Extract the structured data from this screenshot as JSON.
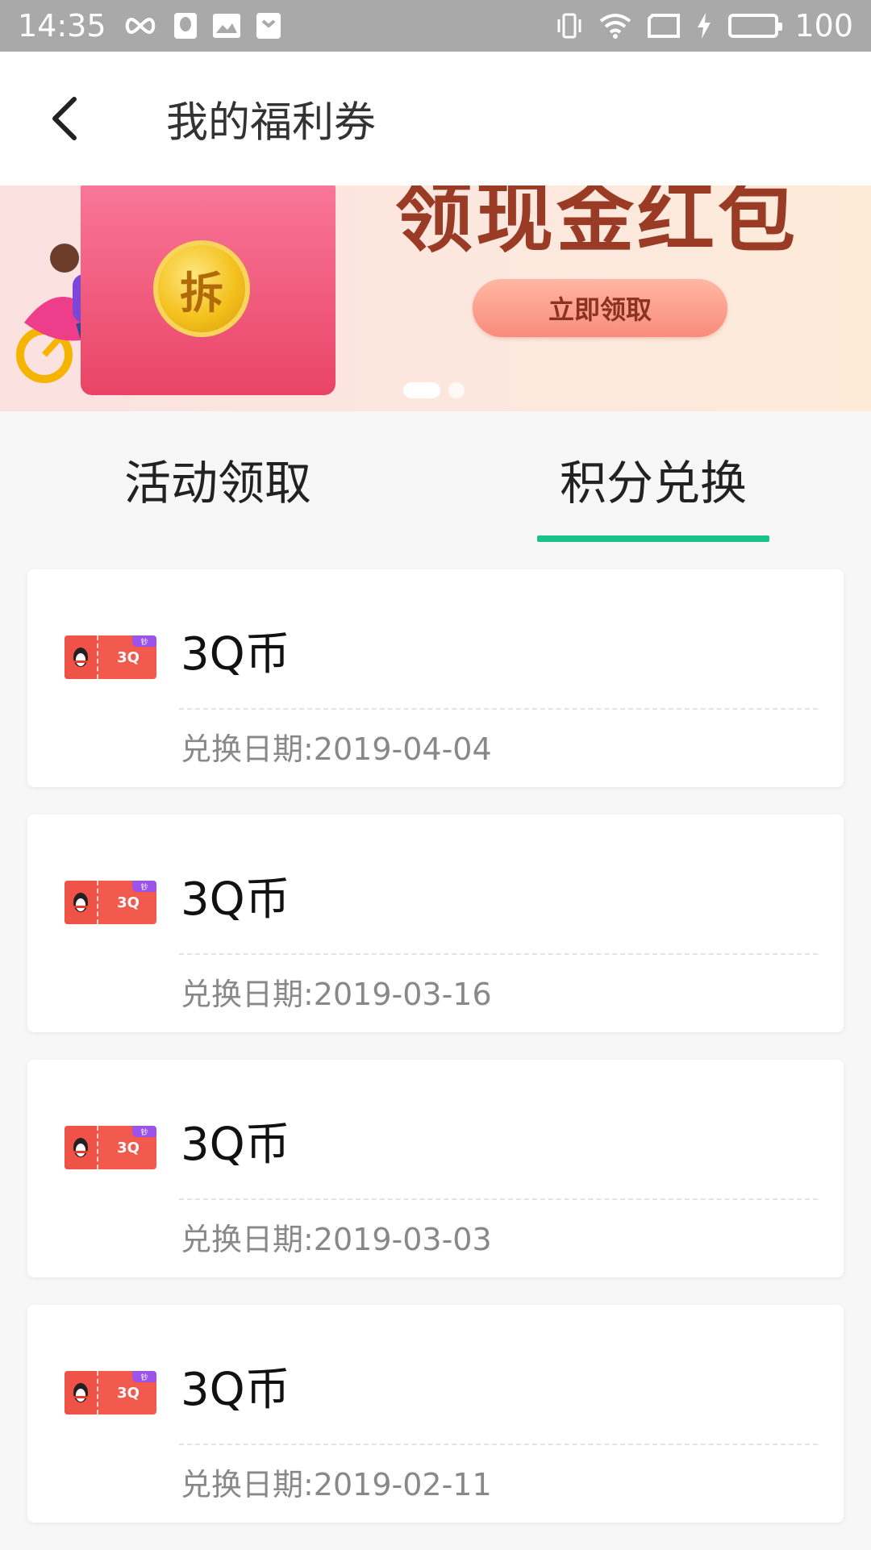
{
  "status_bar": {
    "time": "14:35",
    "battery": "100",
    "icons": [
      "infinity-icon",
      "qq-icon",
      "image-icon",
      "shield-icon",
      "vibrate-icon",
      "wifi-icon",
      "tablet-icon",
      "charging-icon",
      "battery-icon"
    ]
  },
  "header": {
    "title": "我的福利券",
    "back_icon": "back-arrow-icon"
  },
  "banner": {
    "title": "领现金红包",
    "button_label": "立即领取",
    "coin_text": "拆",
    "slide_index": 1,
    "slide_count": 2
  },
  "tabs": [
    {
      "label": "活动领取",
      "active": false
    },
    {
      "label": "积分兑换",
      "active": true
    }
  ],
  "accent_color": "#19c28a",
  "coupons": [
    {
      "title": "3Q币",
      "icon_value": "3Q",
      "badge": "钞",
      "date": "兑换日期:2019-04-04"
    },
    {
      "title": "3Q币",
      "icon_value": "3Q",
      "badge": "钞",
      "date": "兑换日期:2019-03-16"
    },
    {
      "title": "3Q币",
      "icon_value": "3Q",
      "badge": "钞",
      "date": "兑换日期:2019-03-03"
    },
    {
      "title": "3Q币",
      "icon_value": "3Q",
      "badge": "钞",
      "date": "兑换日期:2019-02-11"
    }
  ]
}
